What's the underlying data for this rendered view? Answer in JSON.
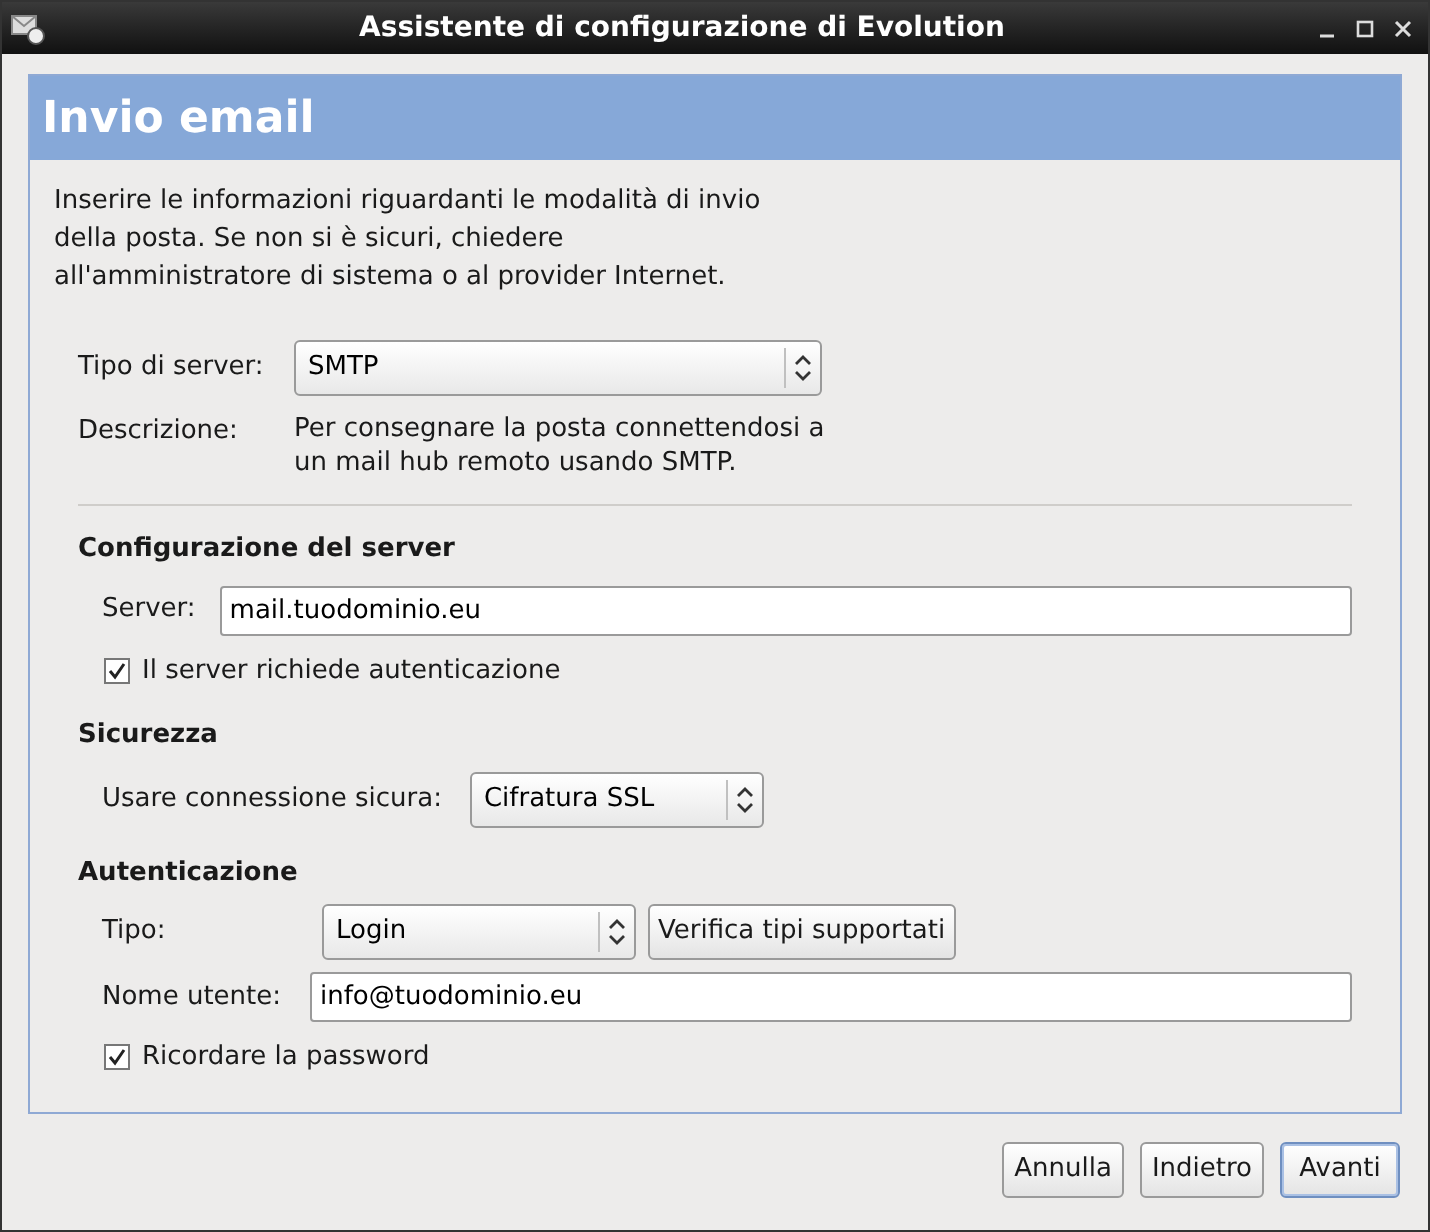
{
  "window": {
    "title": "Assistente di configurazione di Evolution"
  },
  "page": {
    "title": "Invio email",
    "intro": "Inserire le informazioni riguardanti le modalità di invio della posta. Se non si è sicuri, chiedere all'amministratore di sistema o al provider Internet."
  },
  "server_type": {
    "label": "Tipo di server:",
    "value": "SMTP",
    "description_label": "Descrizione:",
    "description": "Per consegnare la posta connettendosi a un mail hub remoto usando SMTP."
  },
  "server_config": {
    "heading": "Configurazione del server",
    "server_label": "Server:",
    "server_value": "mail.tuodominio.eu",
    "auth_required": {
      "label": "Il server richiede autenticazione",
      "checked": true
    }
  },
  "security": {
    "heading": "Sicurezza",
    "label": "Usare connessione sicura:",
    "value": "Cifratura SSL"
  },
  "authentication": {
    "heading": "Autenticazione",
    "type_label": "Tipo:",
    "type_value": "Login",
    "check_button": "Verifica tipi supportati",
    "user_label": "Nome utente:",
    "user_value": "info@tuodominio.eu",
    "remember": {
      "label": "Ricordare la password",
      "checked": true
    }
  },
  "buttons": [
    {
      "label": "Annulla",
      "default": false
    },
    {
      "label": "Indietro",
      "default": false
    },
    {
      "label": "Avanti",
      "default": true
    }
  ]
}
